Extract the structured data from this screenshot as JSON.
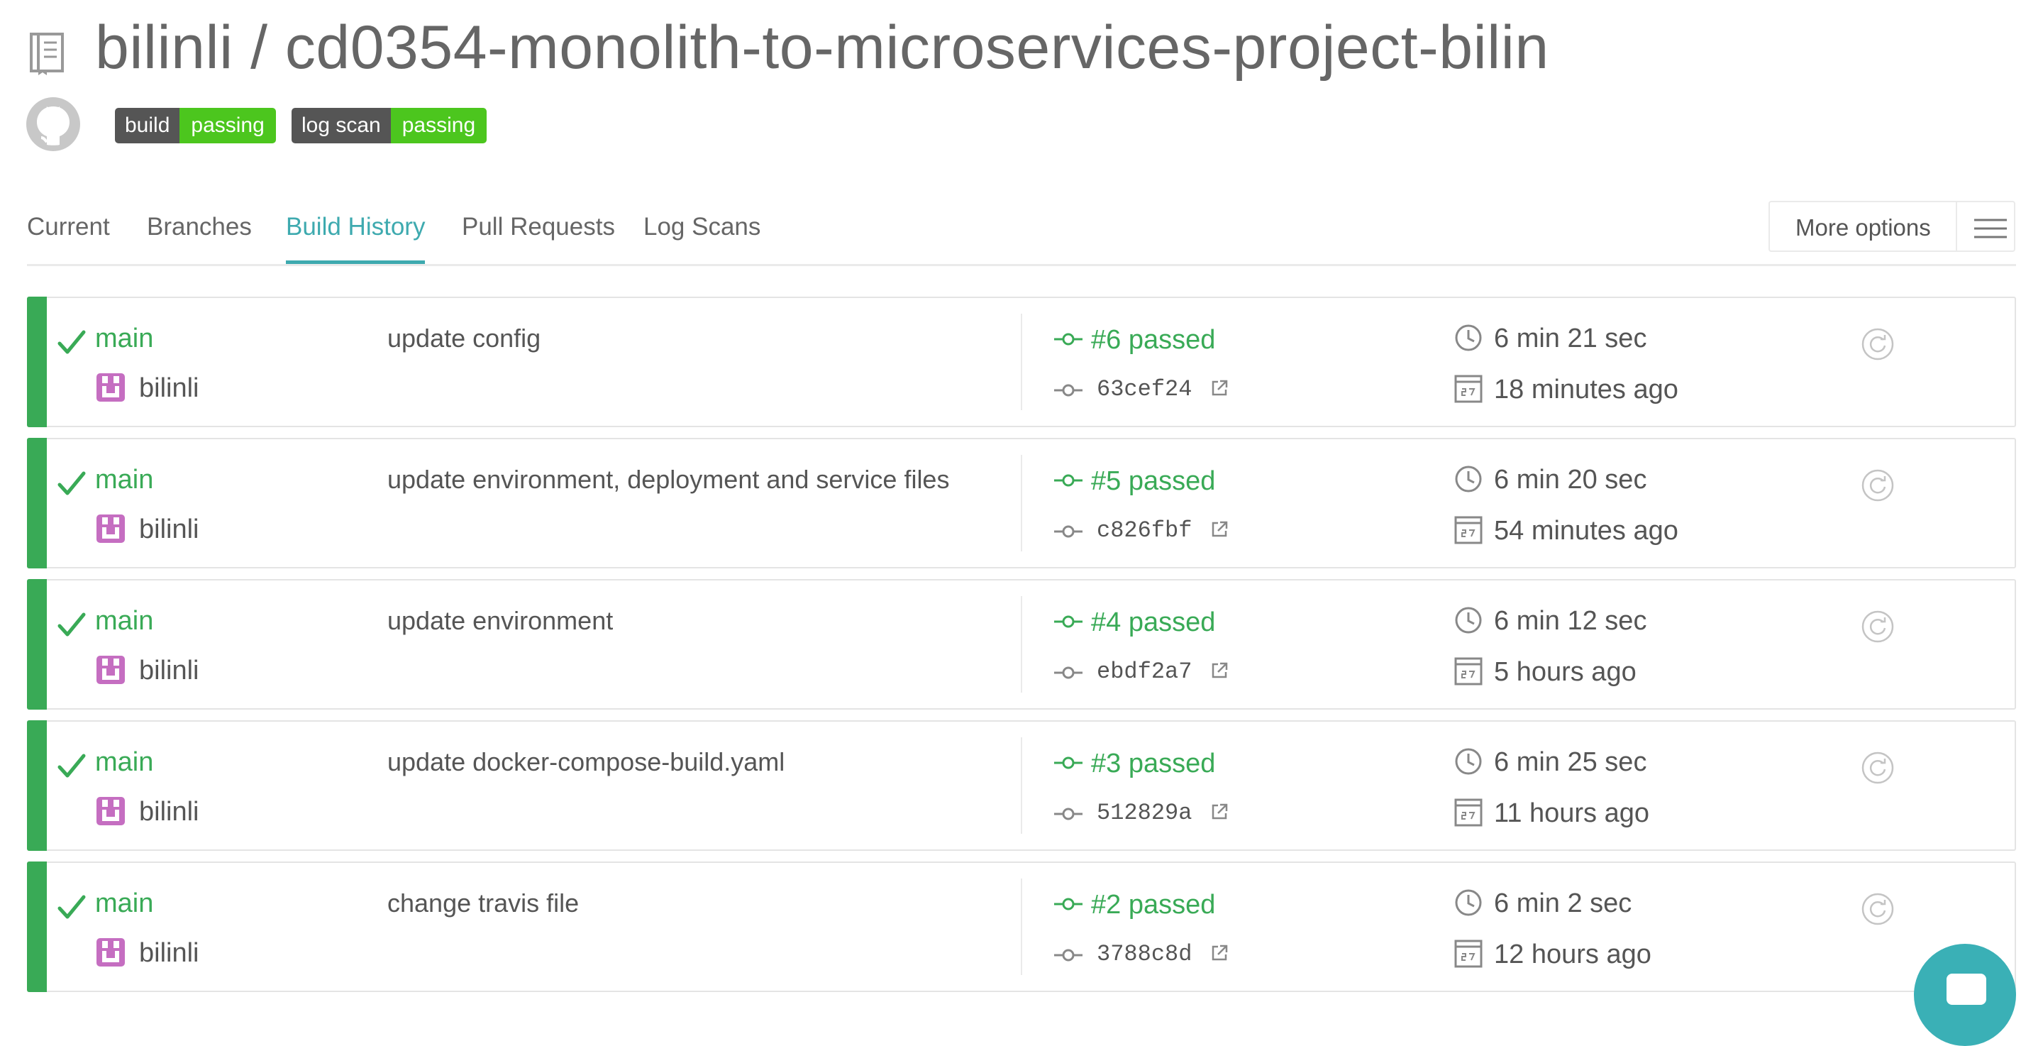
{
  "header": {
    "title": "bilinli / cd0354-monolith-to-microservices-project-bilin",
    "repo_icon": "repo-book-icon",
    "github_icon": "github-icon"
  },
  "badges": [
    {
      "label": "build",
      "status": "passing",
      "status_color": "#4cc61e"
    },
    {
      "label": "log scan",
      "status": "passing",
      "status_color": "#4cc61e"
    }
  ],
  "tabs": [
    "Current",
    "Branches",
    "Build History",
    "Pull Requests",
    "Log Scans"
  ],
  "active_tab": "Build History",
  "more_options": {
    "label": "More options",
    "icon": "hamburger-menu-icon"
  },
  "colors": {
    "passed": "#39aa56",
    "accent": "#3eaaaf"
  },
  "builds": [
    {
      "branch": "main",
      "author": "bilinli",
      "message": "update config",
      "number": "#6 passed",
      "sha": "63cef24",
      "duration": "6 min 21 sec",
      "finished": "18 minutes ago"
    },
    {
      "branch": "main",
      "author": "bilinli",
      "message": "update environment, deployment and service files",
      "number": "#5 passed",
      "sha": "c826fbf",
      "duration": "6 min 20 sec",
      "finished": "54 minutes ago"
    },
    {
      "branch": "main",
      "author": "bilinli",
      "message": "update environment",
      "number": "#4 passed",
      "sha": "ebdf2a7",
      "duration": "6 min 12 sec",
      "finished": "5 hours ago"
    },
    {
      "branch": "main",
      "author": "bilinli",
      "message": "update docker-compose-build.yaml",
      "number": "#3 passed",
      "sha": "512829a",
      "duration": "6 min 25 sec",
      "finished": "11 hours ago"
    },
    {
      "branch": "main",
      "author": "bilinli",
      "message": "change travis file",
      "number": "#2 passed",
      "sha": "3788c8d",
      "duration": "6 min 2 sec",
      "finished": "12 hours ago"
    }
  ]
}
